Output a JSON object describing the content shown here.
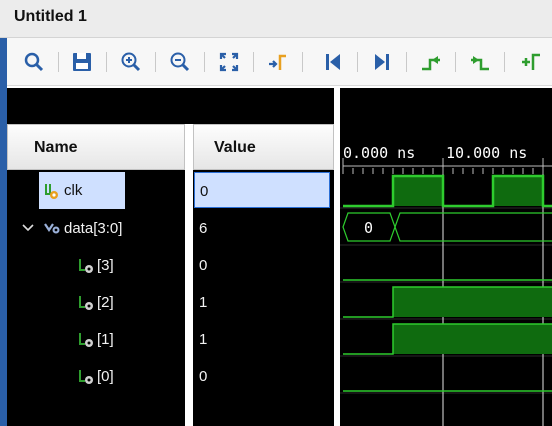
{
  "window": {
    "title": "Untitled 1"
  },
  "toolbar": {
    "buttons": [
      {
        "name": "search",
        "icon": "magnifier-icon"
      },
      {
        "name": "save",
        "icon": "save-icon"
      },
      {
        "name": "zoom-in",
        "icon": "zoom-in-icon"
      },
      {
        "name": "zoom-out",
        "icon": "zoom-out-icon"
      },
      {
        "name": "zoom-fit",
        "icon": "zoom-fit-icon"
      },
      {
        "name": "go-to-cursor",
        "icon": "go-to-cursor-icon"
      },
      {
        "name": "go-to-time-zero",
        "icon": "go-to-time-zero-icon"
      },
      {
        "name": "go-to-last-time",
        "icon": "go-to-last-time-icon"
      },
      {
        "name": "previous-transition",
        "icon": "previous-transition-icon"
      },
      {
        "name": "next-transition",
        "icon": "next-transition-icon"
      },
      {
        "name": "add-marker",
        "icon": "add-marker-icon"
      }
    ]
  },
  "columns": {
    "name": "Name",
    "value": "Value"
  },
  "signals": [
    {
      "id": "clk",
      "label": "clk",
      "value": "0",
      "icon": "clock-signal-icon",
      "selected": true
    },
    {
      "id": "data",
      "label": "data[3:0]",
      "value": "6",
      "icon": "bus-signal-icon",
      "expanded": true
    },
    {
      "id": "data3",
      "label": "[3]",
      "value": "0",
      "icon": "bit-signal-icon"
    },
    {
      "id": "data2",
      "label": "[2]",
      "value": "1",
      "icon": "bit-signal-icon"
    },
    {
      "id": "data1",
      "label": "[1]",
      "value": "1",
      "icon": "bit-signal-icon"
    },
    {
      "id": "data0",
      "label": "[0]",
      "value": "0",
      "icon": "bit-signal-icon"
    }
  ],
  "timeline": {
    "ticks": [
      "0.000 ns",
      "10.000 ns"
    ],
    "bus_value_label": "0"
  },
  "colors": {
    "waveform": "#2ecc2e",
    "waveform_fill": "#0f6b0f",
    "cursor": "#f2f2f2",
    "selection": "#cfe0ff",
    "toolbar_icon_blue": "#2a5fa8",
    "toolbar_icon_green": "#2e9d2e",
    "toolbar_icon_orange": "#e8a020"
  }
}
